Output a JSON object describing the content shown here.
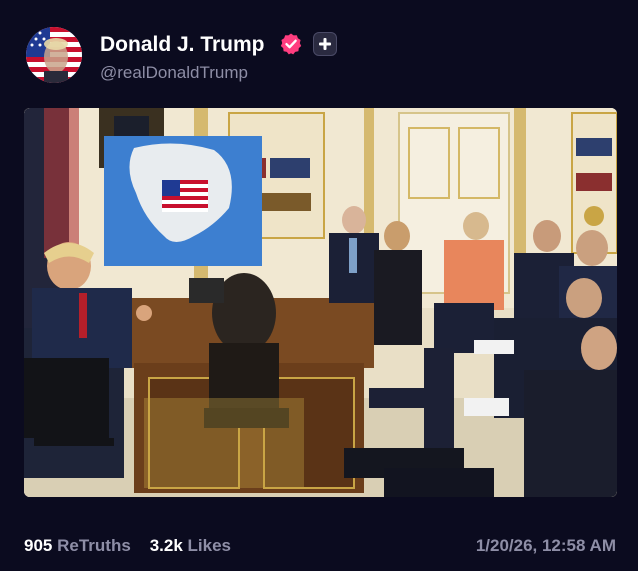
{
  "post": {
    "author": {
      "display_name": "Donald J. Trump",
      "handle": "@realDonaldTrump",
      "avatar_icon": "flag-face-avatar",
      "verified_icon": "verified-badge-icon"
    },
    "follow_icon": "plus-icon",
    "image_description_icon": "meeting-photo",
    "stats": {
      "retruths_count": "905",
      "retruths_label": "ReTruths",
      "likes_count": "3.2k",
      "likes_label": "Likes"
    },
    "timestamp": "1/20/26, 12:58 AM"
  },
  "colors": {
    "background": "#0b0b1f",
    "text_primary": "#ffffff",
    "text_secondary": "#8e8ea6",
    "verified": "#ff3d7f"
  }
}
